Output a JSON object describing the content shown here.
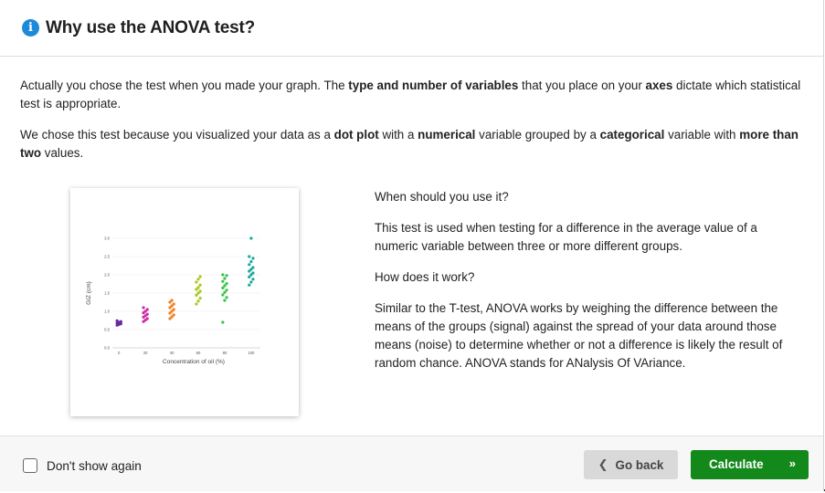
{
  "dialog": {
    "title": "Why use the ANOVA test?",
    "info_icon": "info-icon"
  },
  "intro": {
    "p1": [
      {
        "t": "Actually you chose the test when you made your graph. The ",
        "b": false
      },
      {
        "t": "type and number of variables",
        "b": true
      },
      {
        "t": " that you place on your ",
        "b": false
      },
      {
        "t": "axes",
        "b": true
      },
      {
        "t": " dictate which statistical test is appropriate.",
        "b": false
      }
    ],
    "p2": [
      {
        "t": "We chose this test because you visualized your data as a ",
        "b": false
      },
      {
        "t": "dot plot",
        "b": true
      },
      {
        "t": " with a ",
        "b": false
      },
      {
        "t": "numerical",
        "b": true
      },
      {
        "t": " variable grouped by a ",
        "b": false
      },
      {
        "t": "categorical",
        "b": true
      },
      {
        "t": " variable with ",
        "b": false
      },
      {
        "t": "more than two",
        "b": true
      },
      {
        "t": " values.",
        "b": false
      }
    ]
  },
  "info": {
    "when_heading": "When should you use it?",
    "when_text": "This test is used when testing for a difference in the average value of a numeric variable between three or more different groups.",
    "how_heading": "How does it work?",
    "how_text": "Similar to the T-test, ANOVA works by weighing the difference between the means of the groups (signal) against the spread of your data around those means (noise) to determine whether or not a difference is likely the result of random chance. ANOVA stands for ANalysis Of VAriance."
  },
  "footer": {
    "checkbox_label": "Don't show again",
    "back_label": "Go back",
    "back_icon": "chevron-left-icon",
    "calculate_label": "Calculate",
    "calculate_icon": "double-chevron-right-icon"
  },
  "colors": {
    "info_icon": "#1d8ad8",
    "calculate": "#14891b",
    "back": "#d9d9d9"
  },
  "chart_data": {
    "type": "scatter",
    "xlabel": "Concentration of oil (%)",
    "ylabel": "GIZ (cm)",
    "xlim": [
      -5,
      107
    ],
    "ylim": [
      0,
      3.0
    ],
    "x_ticks": [
      "0",
      "20",
      "40",
      "60",
      "80",
      "100"
    ],
    "y_ticks": [
      "0.0",
      "0.5",
      "1.0",
      "1.5",
      "2.0",
      "2.5",
      "3.0"
    ],
    "groups": [
      {
        "x": 0,
        "color": "#6a2a9e",
        "values": [
          0.62,
          0.64,
          0.66,
          0.68,
          0.7,
          0.72,
          0.74
        ]
      },
      {
        "x": 20,
        "color": "#cc2aa6",
        "values": [
          0.72,
          0.76,
          0.8,
          0.84,
          0.88,
          0.92,
          0.96,
          1.0,
          1.05,
          1.1
        ]
      },
      {
        "x": 40,
        "color": "#f07f22",
        "values": [
          0.8,
          0.85,
          0.9,
          0.95,
          1.0,
          1.05,
          1.1,
          1.15,
          1.2,
          1.25,
          1.3
        ]
      },
      {
        "x": 60,
        "color": "#a6c81e",
        "values": [
          1.2,
          1.28,
          1.36,
          1.44,
          1.5,
          1.55,
          1.6,
          1.65,
          1.72,
          1.8,
          1.88,
          1.95
        ]
      },
      {
        "x": 80,
        "color": "#34c447",
        "values": [
          0.7,
          1.3,
          1.38,
          1.45,
          1.52,
          1.58,
          1.64,
          1.7,
          1.76,
          1.82,
          1.9,
          1.98,
          2.0
        ]
      },
      {
        "x": 100,
        "color": "#18a89a",
        "values": [
          1.72,
          1.8,
          1.88,
          1.94,
          2.0,
          2.05,
          2.1,
          2.15,
          2.2,
          2.28,
          2.36,
          2.45,
          2.5,
          3.0
        ]
      }
    ]
  }
}
